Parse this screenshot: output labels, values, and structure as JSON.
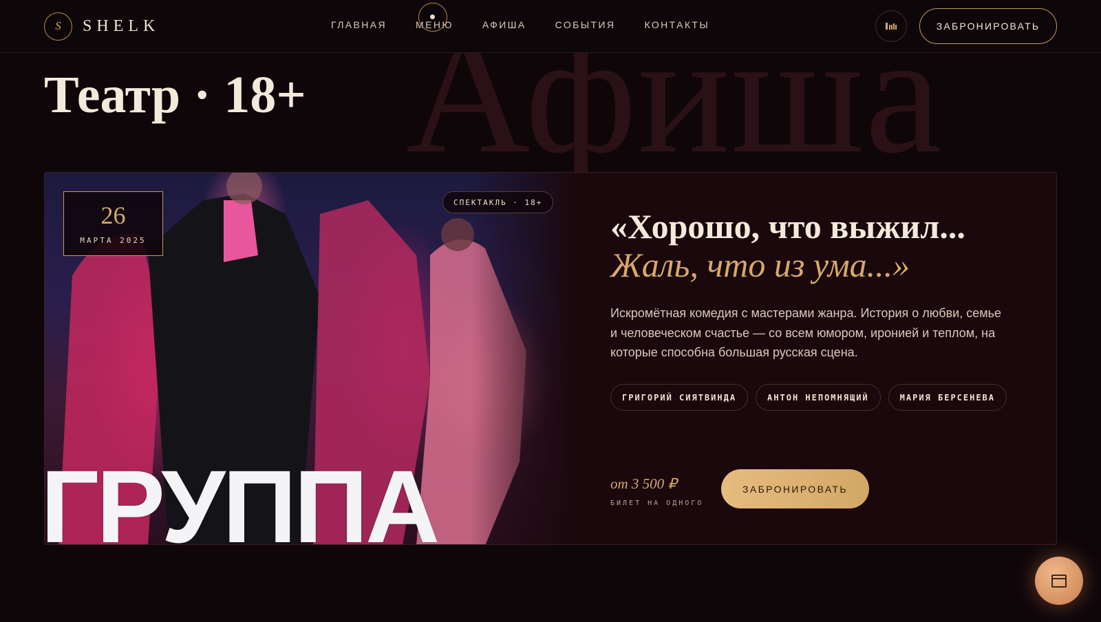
{
  "header": {
    "logo_mark": "S",
    "logo_text": "SHELK",
    "nav": [
      "ГЛАВНАЯ",
      "МЕНЮ",
      "АФИША",
      "СОБЫТИЯ",
      "КОНТАКТЫ"
    ],
    "book_label": "ЗАБРОНИРОВАТЬ",
    "icon": "language-icon"
  },
  "hero": {
    "title": "Театр · 18+",
    "background_word": "Афиша"
  },
  "event": {
    "date_day": "26",
    "date_month": "МАРТА 2025",
    "genre_tag": "СПЕКТАКЛЬ · 18+",
    "poster_word": "ГРУППА",
    "title": "«Хорошо, что выжил...",
    "subtitle": "Жаль, что из ума...»",
    "description": "Искромётная комедия с мастерами жанра. История о любви, семье и человеческом счастье — со всем юмором, иронией и теплом, на которые способна большая русская сцена.",
    "cast": [
      "ГРИГОРИЙ СИЯТВИНДА",
      "АНТОН НЕПОМНЯЩИЙ",
      "МАРИЯ БЕРСЕНЕВА"
    ],
    "price": "от 3 500 ₽",
    "price_note": "БИЛЕТ НА ОДНОГО",
    "book_label": "ЗАБРОНИРОВАТЬ"
  },
  "fab_icon": "calendar-icon",
  "colors": {
    "background": "#0f060a",
    "accent_gold": "#d6a96a",
    "card_background": "#1a080d"
  }
}
